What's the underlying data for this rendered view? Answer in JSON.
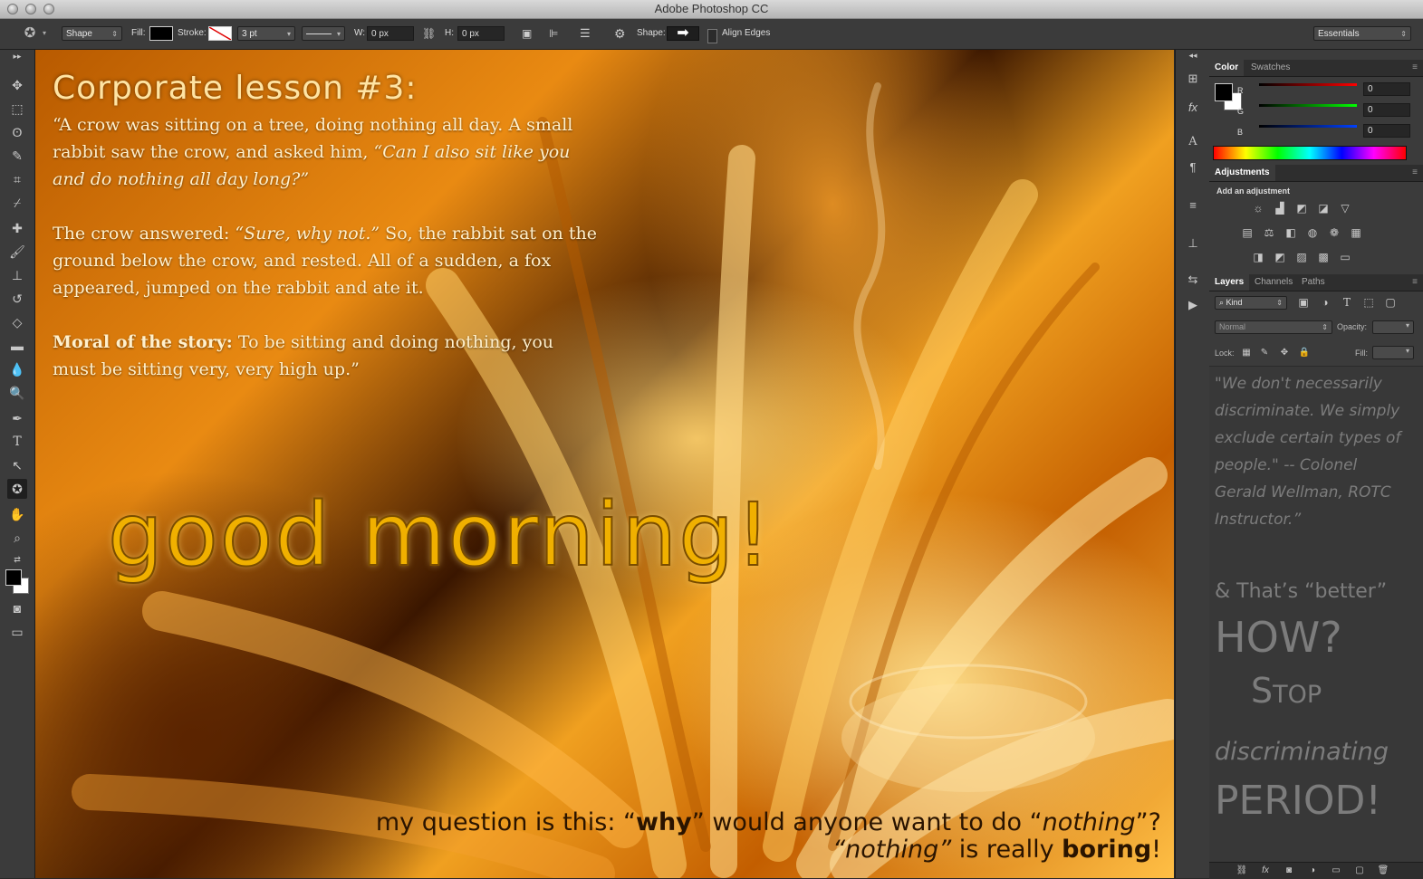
{
  "app": {
    "title": "Adobe Photoshop CC"
  },
  "options_bar": {
    "mode": "Shape",
    "fill_label": "Fill:",
    "stroke_label": "Stroke:",
    "stroke_width": "3 pt",
    "w_label": "W:",
    "w_value": "0 px",
    "h_label": "H:",
    "h_value": "0 px",
    "shape_label": "Shape:",
    "align_edges_label": "Align Edges",
    "workspace": "Essentials"
  },
  "canvas": {
    "lesson_title": "Corporate lesson #3:",
    "p1_a": "“A crow was sitting on a tree, doing nothing all day. A small rabbit saw the crow, and asked him, ",
    "p1_b": "“Can I also sit like you and do nothing all day long?”",
    "p2_a": "The crow answered: ",
    "p2_b": "“Sure, why not.”",
    "p2_c": " So, the rabbit sat on the ground below the crow, and rested. All of a sudden, a fox appeared, jumped on the rabbit and ate it.",
    "p3_a": "Moral of the story:",
    "p3_b": " To be sitting and doing nothing, you must be sitting very, very high up.”",
    "good_morning": "good morning!",
    "q1_a": "my question is this: “",
    "q1_b": "why",
    "q1_c": "” would anyone want to do “",
    "q1_d": "nothing",
    "q1_e": "”?",
    "q2_a": "“nothing”",
    "q2_b": " is really ",
    "q2_c": "boring",
    "q2_d": "!"
  },
  "color_panel": {
    "tabs": [
      "Color",
      "Swatches"
    ],
    "r_label": "R",
    "g_label": "G",
    "b_label": "B",
    "r_value": "0",
    "g_value": "0",
    "b_value": "0"
  },
  "adjustments_panel": {
    "tab": "Adjustments",
    "heading": "Add an adjustment"
  },
  "layers_panel": {
    "tabs": [
      "Layers",
      "Channels",
      "Paths"
    ],
    "kind_label": "Kind",
    "blend_mode": "Normal",
    "opacity_label": "Opacity:",
    "lock_label": "Lock:",
    "fill_label": "Fill:",
    "quote": "\"We don't necessarily discriminate. We simply exclude certain types of people.\" -- Colonel Gerald Wellman, ROTC Instructor.”",
    "better": "& That’s “better”",
    "how": "HOW?",
    "stop": "Stop",
    "discriminating": "discriminating",
    "period": "PERIOD!"
  },
  "colors": {
    "accent_text": "#ffe4a3",
    "slider_red": "#d62020",
    "slider_green": "#20b020",
    "slider_blue": "#2050d8"
  }
}
